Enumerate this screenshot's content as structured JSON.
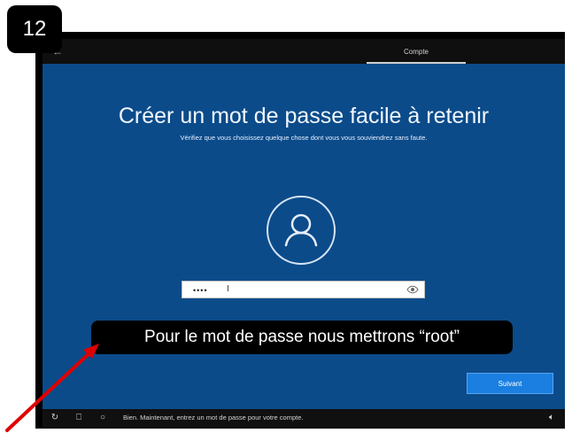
{
  "step_badge": "12",
  "window": {
    "tab": "Compte"
  },
  "setup": {
    "title": "Créer un mot de passe facile à retenir",
    "subtitle": "Vérifiez que vous choisissez quelque chose dont vous vous souviendrez sans faute.",
    "password_masked": "••••",
    "next_button": "Suivant"
  },
  "annotation": {
    "caption": "Pour le mot de passe nous mettrons “root”"
  },
  "taskbar": {
    "narrator_text": "Bien. Maintenant, entrez un mot de passe pour votre compte."
  },
  "colors": {
    "oobe_background": "#0b4b8a",
    "next_button": "#1a7fe0",
    "arrow": "#e00000"
  },
  "icons": [
    "back-arrow-icon",
    "user-icon",
    "eye-icon",
    "accessibility-icon",
    "microphone-icon",
    "cortana-icon",
    "volume-icon"
  ]
}
